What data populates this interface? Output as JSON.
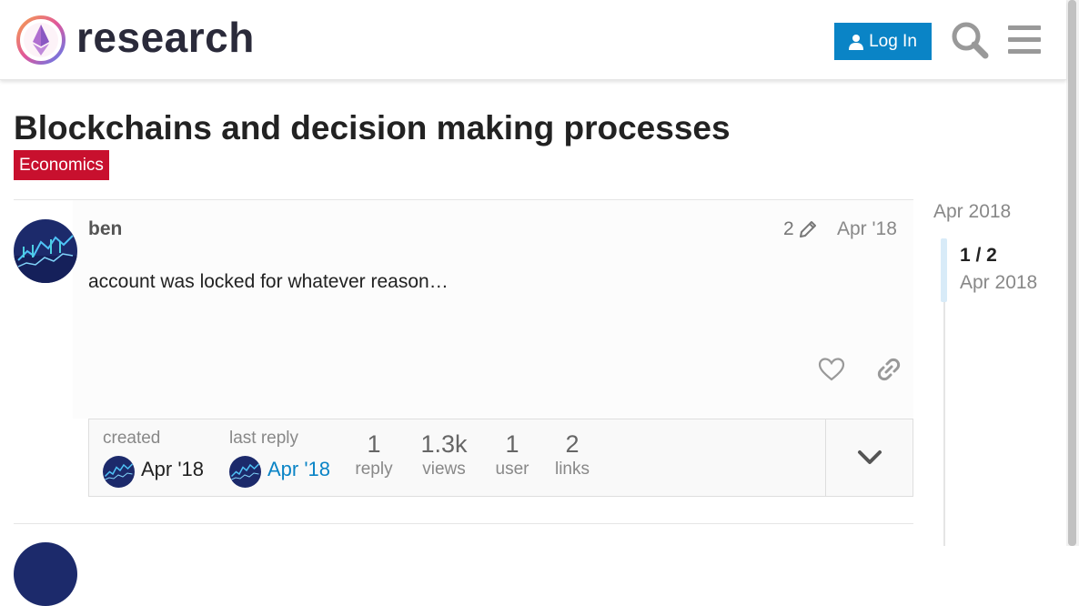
{
  "header": {
    "site_name": "research",
    "login_label": "Log In",
    "logo_icon": "ethereum-research-logo",
    "search_icon": "search-icon",
    "menu_icon": "hamburger-menu-icon"
  },
  "topic": {
    "title": "Blockchains and decision making processes",
    "category": "Economics",
    "category_color": "#c8102e"
  },
  "post": {
    "username": "ben",
    "edit_count": "2",
    "date": "Apr '18",
    "body": "account was locked for whatever reason…"
  },
  "topic_map": {
    "created_label": "created",
    "created_date": "Apr '18",
    "last_reply_label": "last reply",
    "last_reply_date": "Apr '18",
    "stats": [
      {
        "num": "1",
        "label": "reply"
      },
      {
        "num": "1.3k",
        "label": "views"
      },
      {
        "num": "1",
        "label": "user"
      },
      {
        "num": "2",
        "label": "links"
      }
    ]
  },
  "timeline": {
    "start": "Apr 2018",
    "count": "1 / 2",
    "current_date": "Apr 2018"
  },
  "colors": {
    "accent": "#0a84c6",
    "link": "#0a84c6"
  }
}
